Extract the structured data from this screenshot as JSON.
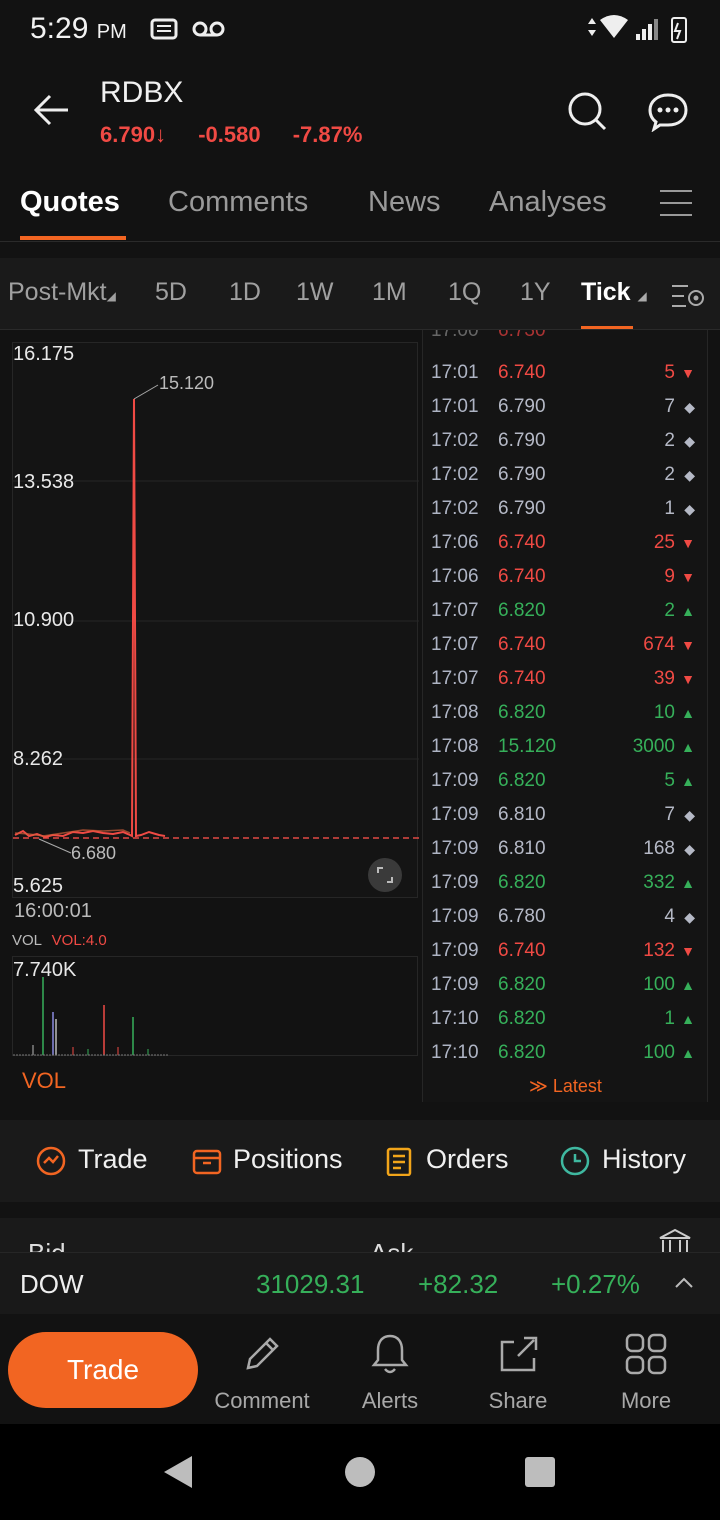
{
  "status": {
    "time": "5:29",
    "ampm": "PM"
  },
  "header": {
    "ticker": "RDBX",
    "price": "6.790",
    "price_arrow": "↓",
    "change": "-0.580",
    "change_pct": "-7.87%"
  },
  "tabs": [
    {
      "label": "Quotes"
    },
    {
      "label": "Comments"
    },
    {
      "label": "News"
    },
    {
      "label": "Analyses"
    }
  ],
  "periods": [
    {
      "label": "Post-Mkt"
    },
    {
      "label": "5D"
    },
    {
      "label": "1D"
    },
    {
      "label": "1W"
    },
    {
      "label": "1M"
    },
    {
      "label": "1Q"
    },
    {
      "label": "1Y"
    },
    {
      "label": "Tick"
    }
  ],
  "chart": {
    "y_labels": [
      "16.175",
      "13.538",
      "10.900",
      "8.262",
      "5.625"
    ],
    "high_label": "15.120",
    "low_label": "6.680",
    "time_label": "16:00:01",
    "vol_label": "VOL",
    "vol_value": "VOL:4.0",
    "vol_max": "7.740K",
    "vol_footer": "VOL"
  },
  "tick_list": {
    "rows": [
      {
        "time": "17:01",
        "price": "6.740",
        "vol": "5",
        "dir": "down"
      },
      {
        "time": "17:01",
        "price": "6.790",
        "vol": "7",
        "dir": "flat"
      },
      {
        "time": "17:02",
        "price": "6.790",
        "vol": "2",
        "dir": "flat"
      },
      {
        "time": "17:02",
        "price": "6.790",
        "vol": "2",
        "dir": "flat"
      },
      {
        "time": "17:02",
        "price": "6.790",
        "vol": "1",
        "dir": "flat"
      },
      {
        "time": "17:06",
        "price": "6.740",
        "vol": "25",
        "dir": "down"
      },
      {
        "time": "17:06",
        "price": "6.740",
        "vol": "9",
        "dir": "down"
      },
      {
        "time": "17:07",
        "price": "6.820",
        "vol": "2",
        "dir": "up"
      },
      {
        "time": "17:07",
        "price": "6.740",
        "vol": "674",
        "dir": "down"
      },
      {
        "time": "17:07",
        "price": "6.740",
        "vol": "39",
        "dir": "down"
      },
      {
        "time": "17:08",
        "price": "6.820",
        "vol": "10",
        "dir": "up"
      },
      {
        "time": "17:08",
        "price": "15.120",
        "vol": "3000",
        "dir": "up"
      },
      {
        "time": "17:09",
        "price": "6.820",
        "vol": "5",
        "dir": "up"
      },
      {
        "time": "17:09",
        "price": "6.810",
        "vol": "7",
        "dir": "flat"
      },
      {
        "time": "17:09",
        "price": "6.810",
        "vol": "168",
        "dir": "flat"
      },
      {
        "time": "17:09",
        "price": "6.820",
        "vol": "332",
        "dir": "up"
      },
      {
        "time": "17:09",
        "price": "6.780",
        "vol": "4",
        "dir": "flat"
      },
      {
        "time": "17:09",
        "price": "6.740",
        "vol": "132",
        "dir": "down"
      },
      {
        "time": "17:09",
        "price": "6.820",
        "vol": "100",
        "dir": "up"
      },
      {
        "time": "17:10",
        "price": "6.820",
        "vol": "1",
        "dir": "up"
      },
      {
        "time": "17:10",
        "price": "6.820",
        "vol": "100",
        "dir": "up"
      }
    ],
    "latest_label": "Latest"
  },
  "actions": [
    {
      "label": "Trade"
    },
    {
      "label": "Positions"
    },
    {
      "label": "Orders"
    },
    {
      "label": "History"
    }
  ],
  "bidask": {
    "bid": "Bid",
    "ask": "Ask"
  },
  "index_bar": {
    "name": "DOW",
    "value": "31029.31",
    "change": "+82.32",
    "change_pct": "+0.27%"
  },
  "bottom_bar": {
    "trade": "Trade",
    "items": [
      {
        "label": "Comment"
      },
      {
        "label": "Alerts"
      },
      {
        "label": "Share"
      },
      {
        "label": "More"
      }
    ]
  },
  "colors": {
    "accent": "#f26522",
    "down": "#f04a44",
    "up": "#36b05a"
  }
}
